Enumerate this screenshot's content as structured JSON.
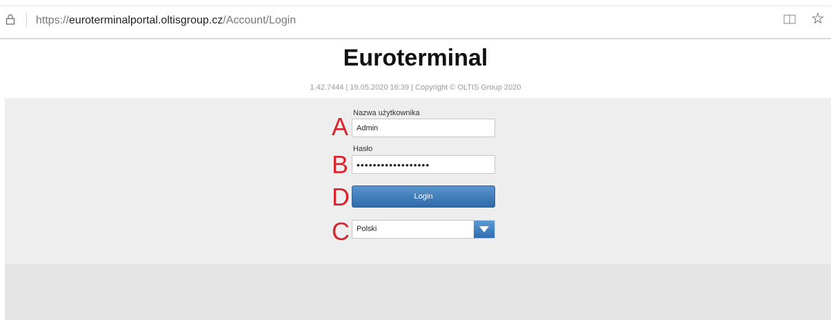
{
  "browser": {
    "url_scheme": "https://",
    "url_host": "euroterminalportal.oltisgroup.cz",
    "url_path": "/Account/Login"
  },
  "header": {
    "title": "Euroterminal",
    "version_info": "1.42.7444 | 19.05.2020 16:39 | Copyright © OLTIS Group 2020"
  },
  "form": {
    "username_label": "Nazwa użytkownika",
    "username_value": "Admin",
    "password_label": "Hasło",
    "password_value": "••••••••••••••••••",
    "login_label": "Login",
    "language_value": "Polski"
  },
  "annotations": {
    "a": "A",
    "b": "B",
    "d": "D",
    "c": "C"
  },
  "colors": {
    "accent": "#2f69a8",
    "annotation": "#d6262f"
  }
}
